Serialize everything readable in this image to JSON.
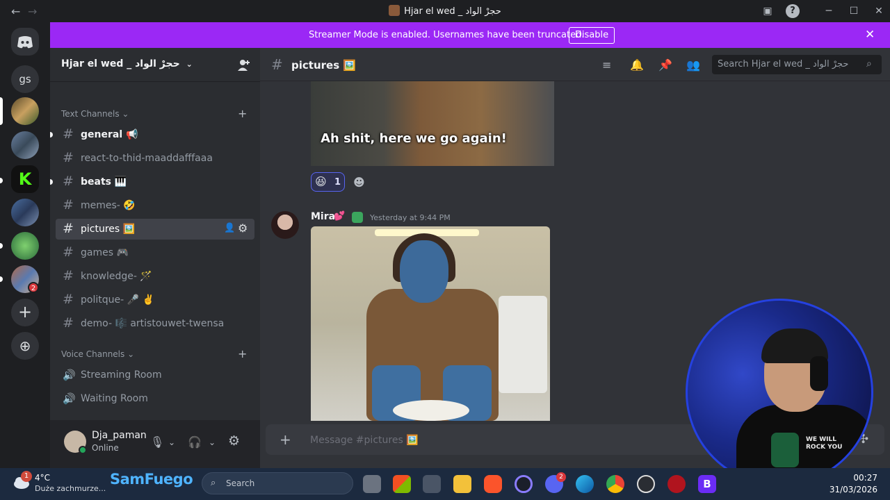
{
  "window": {
    "title": "Hjar el wed _ حجرْ الواد",
    "back": "←",
    "forward": "→",
    "minimize": "─",
    "maximize": "☐",
    "close": "✕"
  },
  "banner": {
    "message": "Streamer Mode is enabled. Usernames have been truncated.",
    "disable_label": "Disable",
    "close": "✕"
  },
  "rail": {
    "home_label": "gs",
    "badge_count": "2",
    "add": "+",
    "explore": "⊕"
  },
  "sidebar": {
    "server_name": "Hjar el wed _ حجرْ الواد",
    "text_category": "Text Channels",
    "voice_category": "Voice Channels",
    "add": "+",
    "text_channels": [
      {
        "name": "general 📢",
        "unread": true
      },
      {
        "name": "react-to-thid-maaddafffaaa",
        "unread": false
      },
      {
        "name": "beats 🎹",
        "unread": true
      },
      {
        "name": "memes- 🤣",
        "unread": false
      },
      {
        "name": "pictures 🖼️",
        "unread": false,
        "active": true
      },
      {
        "name": "games 🎮",
        "unread": false
      },
      {
        "name": "knowledge- 🪄",
        "unread": false
      },
      {
        "name": "politque- 🎤 ✌️",
        "unread": false
      },
      {
        "name": "demo- 🎼 artistouwet-twensa",
        "unread": false
      }
    ],
    "voice_channels": [
      {
        "name": "Streaming Room"
      },
      {
        "name": "Waiting Room"
      }
    ]
  },
  "user_panel": {
    "username": "Dja_paman",
    "status": "Online"
  },
  "channel": {
    "name": "pictures 🖼️",
    "search_placeholder": "Search Hjar el wed _ حجرْ الواد"
  },
  "messages": {
    "caption": "Ah shit, here we go again!",
    "reaction_emoji": "😆",
    "reaction_count": "1",
    "author": "Mira",
    "author_heart": "💕",
    "timestamp": "Yesterday at 9:44 PM"
  },
  "composer": {
    "placeholder": "Message #pictures 🖼️",
    "plus": "+"
  },
  "webcam": {
    "shirt_text": "WE WILL\nROCK YOU"
  },
  "taskbar": {
    "temperature": "4°C",
    "condition": "Duże zachmurze...",
    "weather_badge": "1",
    "brand_text": "SamFuego",
    "search_placeholder": "Search",
    "time": "00:27",
    "date": "31/03/2026",
    "discord_badge": "2"
  },
  "colors": {
    "banner": "#9b28f5",
    "active_channel": "#404249",
    "reaction_border": "#5865f2",
    "online": "#23a55a"
  }
}
